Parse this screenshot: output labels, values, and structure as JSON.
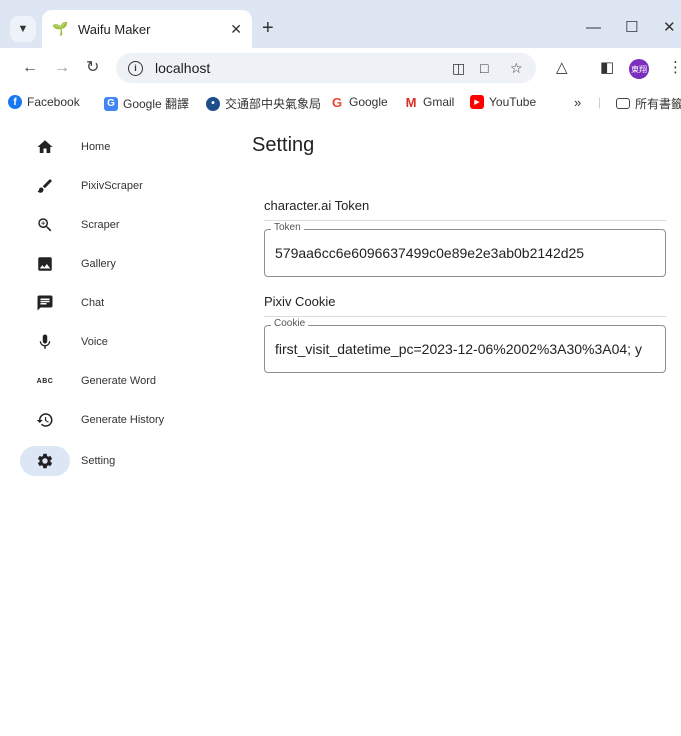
{
  "browser": {
    "tab_title": "Waifu Maker",
    "url": "localhost",
    "bookmarks": [
      {
        "label": "Facebook"
      },
      {
        "label": "Google 翻譯"
      },
      {
        "label": "交通部中央氣象局"
      },
      {
        "label": "Google"
      },
      {
        "label": "Gmail"
      },
      {
        "label": "YouTube"
      }
    ],
    "all_bookmarks": "所有書籤",
    "profile_initials": "東翔"
  },
  "sidebar": {
    "items": [
      {
        "label": "Home",
        "icon": "home-icon"
      },
      {
        "label": "PixivScraper",
        "icon": "brush-icon"
      },
      {
        "label": "Scraper",
        "icon": "zoom-in-icon"
      },
      {
        "label": "Gallery",
        "icon": "image-icon"
      },
      {
        "label": "Chat",
        "icon": "chat-icon"
      },
      {
        "label": "Voice",
        "icon": "mic-icon"
      },
      {
        "label": "Generate Word",
        "icon": "abc-icon"
      },
      {
        "label": "Generate History",
        "icon": "history-icon"
      },
      {
        "label": "Setting",
        "icon": "settings-icon",
        "active": true
      }
    ],
    "abc_glyph": "ABC"
  },
  "main": {
    "title": "Setting",
    "sections": [
      {
        "heading": "character.ai Token",
        "field_label": "Token",
        "value": "579aa6cc6e6096637499c0e89e2e3ab0b2142d25"
      },
      {
        "heading": "Pixiv Cookie",
        "field_label": "Cookie",
        "value": "first_visit_datetime_pc=2023-12-06%2002%3A30%3A04; y"
      }
    ]
  },
  "colors": {
    "active_nav_bg": "#dce6f5",
    "tabbar_bg": "#dfe6f3"
  }
}
